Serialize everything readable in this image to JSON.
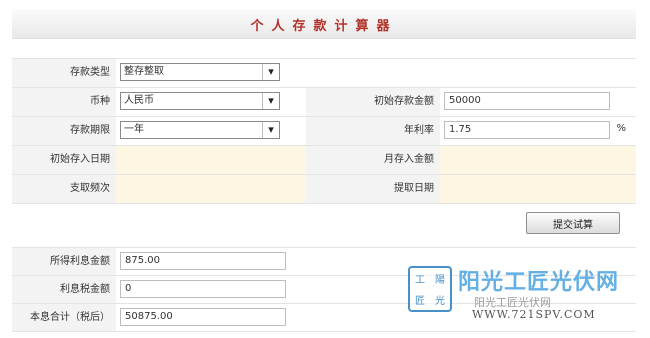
{
  "title": "个人存款计算器",
  "form": {
    "deposit_type": {
      "label": "存款类型",
      "value": "整存整取"
    },
    "currency": {
      "label": "币种",
      "value": "人民币"
    },
    "initial_amount": {
      "label": "初始存款金额",
      "value": "50000"
    },
    "term": {
      "label": "存款期限",
      "value": "一年"
    },
    "annual_rate": {
      "label": "年利率",
      "value": "1.75",
      "unit": "%"
    },
    "start_date": {
      "label": "初始存入日期",
      "value": ""
    },
    "monthly_amount": {
      "label": "月存入金额",
      "value": ""
    },
    "withdraw_freq": {
      "label": "支取频次",
      "value": ""
    },
    "withdraw_date": {
      "label": "提取日期",
      "value": ""
    }
  },
  "submit_label": "提交试算",
  "results": {
    "interest": {
      "label": "所得利息金额",
      "value": "875.00"
    },
    "interest_tax": {
      "label": "利息税金额",
      "value": "0"
    },
    "total_after_tax": {
      "label": "本息合计（税后）",
      "value": "50875.00"
    }
  },
  "watermark": {
    "seal_chars": [
      "工",
      "陽",
      "匠",
      "光"
    ],
    "brand": "阳光工匠光伏网",
    "sub": "阳光工匠光伏网",
    "url": "WWW.721SPV.COM"
  },
  "colors": {
    "title": "#b3312b",
    "brand": "#4aa3e0"
  }
}
